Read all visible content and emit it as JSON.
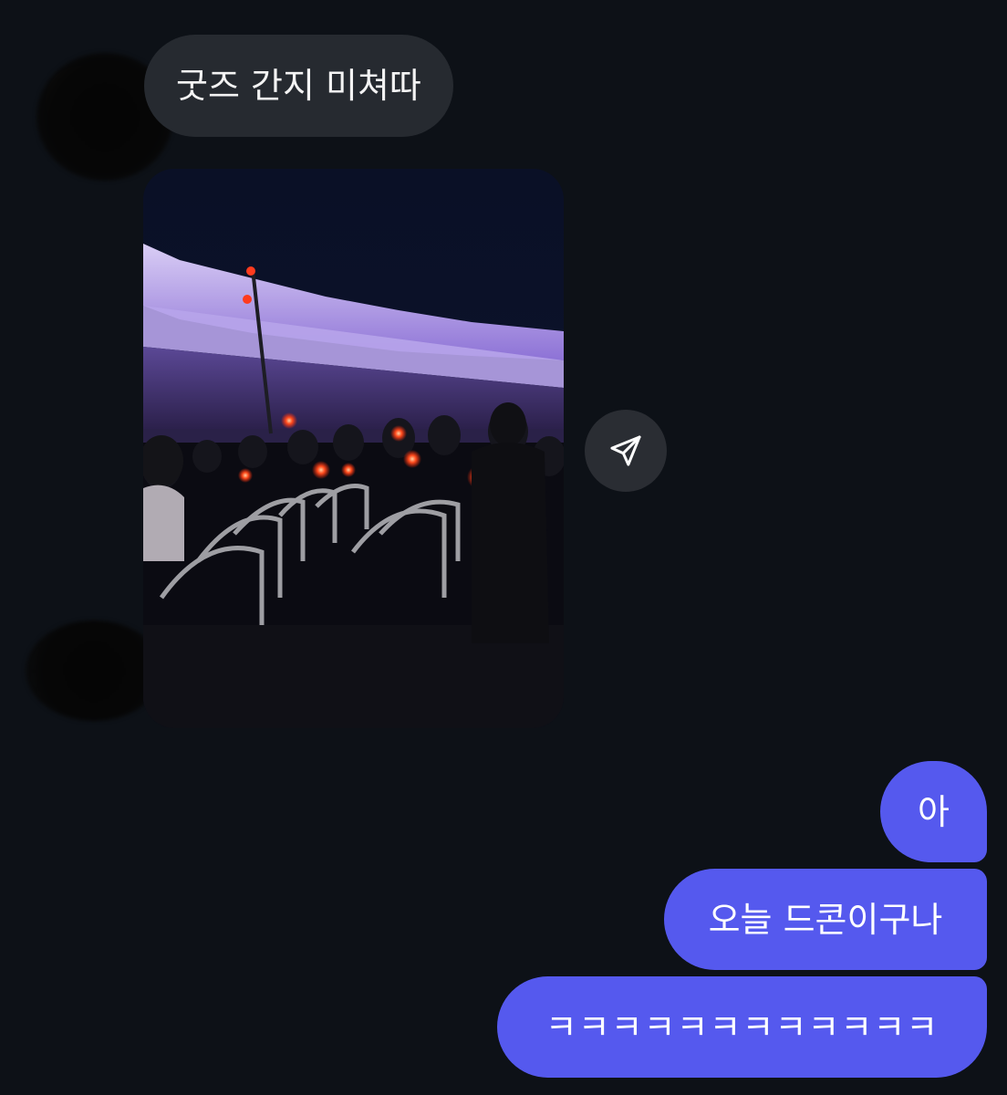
{
  "conversation": {
    "incoming": {
      "text": "굿즈 간지 미쳐따",
      "photo_subject": "concert-crowd-photo"
    },
    "outgoing": [
      {
        "text": "아"
      },
      {
        "text": "오늘 드콘이구나"
      },
      {
        "text": "ㅋㅋㅋㅋㅋㅋㅋㅋㅋㅋㅋㅋ"
      }
    ]
  },
  "actions": {
    "share_icon": "send-icon"
  },
  "colors": {
    "background": "#0d1117",
    "incoming_bubble": "#262a30",
    "outgoing_bubble": "#5559ee",
    "share_button": "#2a2d33",
    "stage_lights": "#8a70d8",
    "lightstick": "#ff3b1e"
  }
}
